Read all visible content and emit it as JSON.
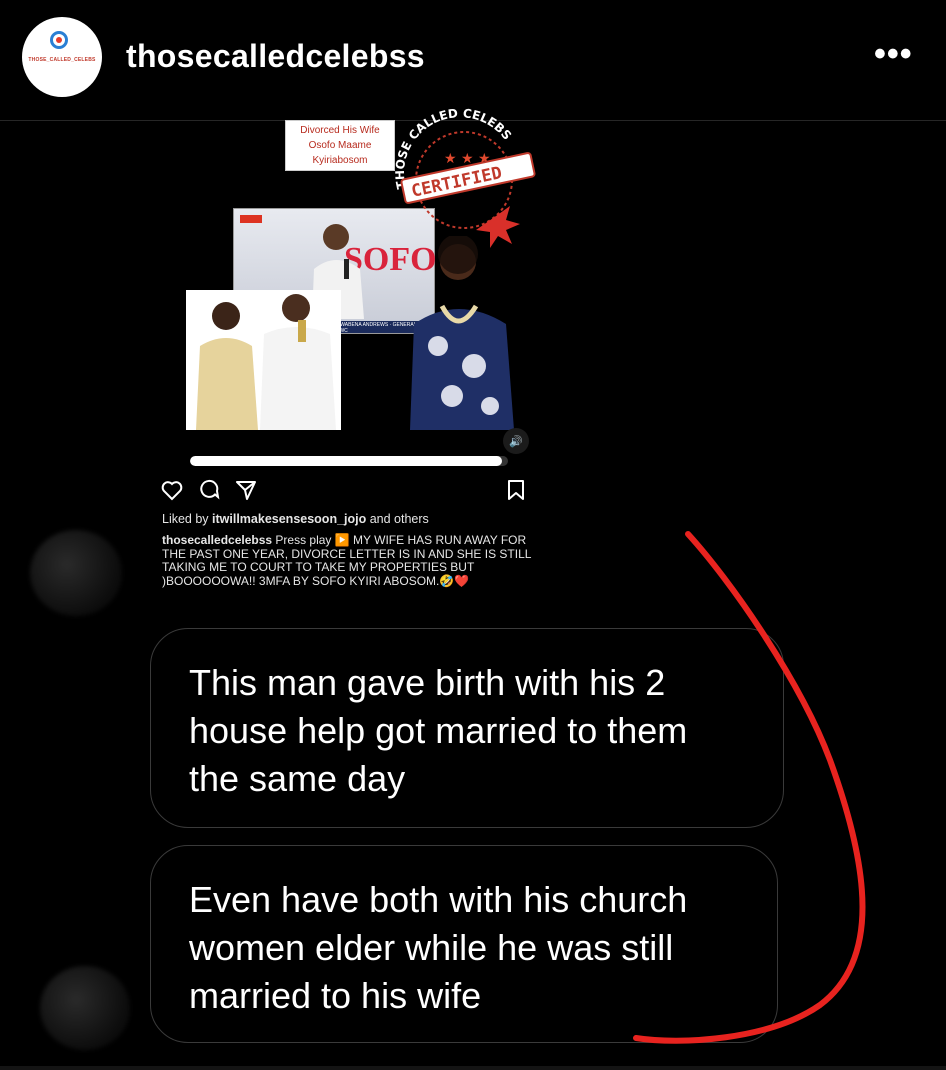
{
  "header": {
    "username": "thosecalledcelebss",
    "avatar_text": "THOSE_CALLED_CELEBS",
    "more_label": "•••"
  },
  "post": {
    "overlay_caption": [
      "Divorced His Wife",
      "Osofo Maame",
      "Kyiriabosom"
    ],
    "stamp_text": "THOSE CALLED CELEBS",
    "stamp_label": "CERTIFIED",
    "video_text": "SOFO",
    "video_bar_text": "REV. CHRISTIAN KWABENA ANDREWS · GENERAL OVERSEER OF LAWC",
    "progress": 0.98,
    "liked_by_user": "itwillmakesensesoon_jojo",
    "liked_by_rest": " and others",
    "liked_by_prefix": "Liked by ",
    "caption_user": "thosecalledcelebss",
    "caption_text": " Press play ▶️ MY WIFE HAS RUN AWAY FOR THE PAST ONE YEAR, DIVORCE LETTER IS IN AND SHE IS STILL TAKING ME TO COURT TO TAKE MY PROPERTIES BUT )BOOOOOOWA!! 3MFA BY SOFO KYIRI ABOSOM.🤣❤️"
  },
  "messages": [
    {
      "text": "This man gave birth with his 2 house help got married to them the same day"
    },
    {
      "text": "Even have both with his church women elder while he was still married to his wife"
    }
  ],
  "colors": {
    "background": "#000000",
    "annotation_red": "#e8231f",
    "bubble_border": "#3a3a3a"
  }
}
